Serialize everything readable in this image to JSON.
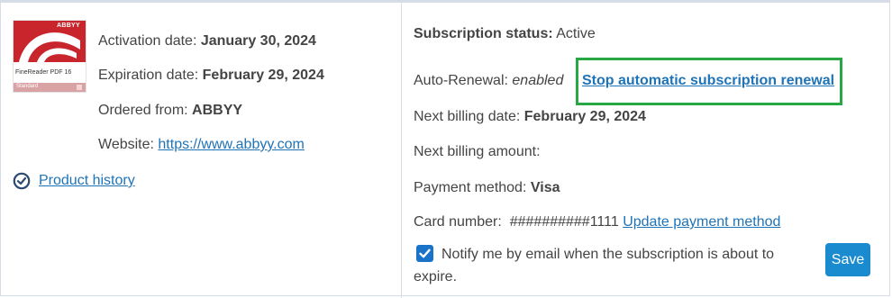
{
  "product": {
    "logo": {
      "brand": "ABBYY",
      "product_name": "FineReader PDF 16",
      "edition": "Standard"
    },
    "activation_label": "Activation date:",
    "activation_value": "January 30, 2024",
    "expiration_label": "Expiration date:",
    "expiration_value": "February 29, 2024",
    "ordered_label": "Ordered from:",
    "ordered_value": "ABBYY",
    "website_label": "Website:",
    "website_value": "https://www.abbyy.com",
    "history_link": "Product history",
    "history_icon": "clock-check-icon"
  },
  "subscription": {
    "status_label": "Subscription status:",
    "status_value": "Active",
    "auto_renewal_label": "Auto-Renewal:",
    "auto_renewal_value": "enabled",
    "stop_renewal_link": "Stop automatic subscription renewal",
    "next_billing_date_label": "Next billing date:",
    "next_billing_date_value": "February 29, 2024",
    "next_billing_amount_label": "Next billing amount:",
    "next_billing_amount_value": "",
    "payment_method_label": "Payment method:",
    "payment_method_value": "Visa",
    "card_number_label": "Card number:",
    "card_number_value": "##########1111",
    "update_payment_link": "Update payment method",
    "notify_text": "Notify me by email when the subscription is about to expire.",
    "notify_checked": true,
    "save_label": "Save"
  },
  "colors": {
    "link": "#1f73b7",
    "highlight_border": "#28a745",
    "save_button": "#1b8bd0",
    "checkbox": "#1a73c9",
    "logo_red": "#c8262c"
  }
}
